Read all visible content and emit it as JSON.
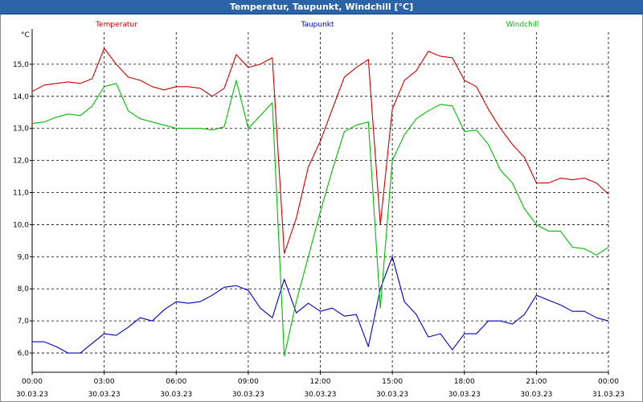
{
  "window": {
    "title": "Temperatur, Taupunkt, Windchill [°C]"
  },
  "colors": {
    "temperatur": "#cc0000",
    "taupunkt": "#0000cc",
    "windchill": "#00bb00",
    "titlebar": "#2a63a8"
  },
  "chart_data": {
    "type": "line",
    "title": "Temperatur, Taupunkt, Windchill [°C]",
    "ylabel": "°C",
    "xlabel": "",
    "ylim": [
      5.4,
      16.0
    ],
    "xlim": [
      0,
      24
    ],
    "grid": true,
    "grid_style": "dashed",
    "yticks": [
      6.0,
      7.0,
      8.0,
      9.0,
      10.0,
      11.0,
      12.0,
      13.0,
      14.0,
      15.0
    ],
    "ytick_labels": [
      "6,0",
      "7,0",
      "8,0",
      "9,0",
      "10,0",
      "11,0",
      "12,0",
      "13,0",
      "14,0",
      "15,0"
    ],
    "xticks": [
      {
        "time": "00:00",
        "date": "30.03.23"
      },
      {
        "time": "03:00",
        "date": "30.03.23"
      },
      {
        "time": "06:00",
        "date": "30.03.23"
      },
      {
        "time": "09:00",
        "date": "30.03.23"
      },
      {
        "time": "12:00",
        "date": "30.03.23"
      },
      {
        "time": "15:00",
        "date": "30.03.23"
      },
      {
        "time": "18:00",
        "date": "30.03.23"
      },
      {
        "time": "21:00",
        "date": "30.03.23"
      },
      {
        "time": "00:00",
        "date": "31.03.23"
      }
    ],
    "x": [
      0.0,
      0.5,
      1.0,
      1.5,
      2.0,
      2.5,
      3.0,
      3.5,
      4.0,
      4.5,
      5.0,
      5.5,
      6.0,
      6.5,
      7.0,
      7.5,
      8.0,
      8.5,
      9.0,
      9.5,
      10.0,
      10.5,
      11.0,
      11.5,
      12.0,
      12.5,
      13.0,
      13.5,
      14.0,
      14.5,
      15.0,
      15.5,
      16.0,
      16.5,
      17.0,
      17.5,
      18.0,
      18.5,
      19.0,
      19.5,
      20.0,
      20.5,
      21.0,
      21.5,
      22.0,
      22.5,
      23.0,
      23.5,
      24.0
    ],
    "series": [
      {
        "name": "Temperatur",
        "color": "#cc0000",
        "values": [
          14.15,
          14.35,
          14.4,
          14.45,
          14.4,
          14.55,
          15.5,
          15.0,
          14.6,
          14.5,
          14.3,
          14.2,
          14.3,
          14.3,
          14.25,
          14.0,
          14.25,
          15.3,
          14.9,
          15.0,
          15.2,
          9.1,
          10.2,
          11.8,
          12.6,
          13.6,
          14.6,
          14.9,
          15.15,
          10.0,
          13.6,
          14.5,
          14.8,
          15.4,
          15.25,
          15.2,
          14.5,
          14.3,
          13.6,
          13.0,
          12.5,
          12.1,
          11.3,
          11.3,
          11.45,
          11.4,
          11.45,
          11.3,
          10.95
        ]
      },
      {
        "name": "Taupunkt",
        "color": "#0000cc",
        "values": [
          6.35,
          6.35,
          6.2,
          6.0,
          6.0,
          6.3,
          6.6,
          6.55,
          6.8,
          7.1,
          7.0,
          7.35,
          7.6,
          7.55,
          7.6,
          7.8,
          8.05,
          8.1,
          7.95,
          7.4,
          7.1,
          8.3,
          7.25,
          7.55,
          7.3,
          7.4,
          7.15,
          7.2,
          6.2,
          8.0,
          9.0,
          7.6,
          7.2,
          6.5,
          6.6,
          6.1,
          6.6,
          6.6,
          7.0,
          7.0,
          6.9,
          7.2,
          7.8,
          7.65,
          7.5,
          7.3,
          7.3,
          7.1,
          7.0
        ]
      },
      {
        "name": "Windchill",
        "color": "#00bb00",
        "values": [
          13.15,
          13.2,
          13.35,
          13.45,
          13.4,
          13.7,
          14.3,
          14.4,
          13.55,
          13.3,
          13.2,
          13.1,
          13.0,
          13.0,
          13.0,
          12.95,
          13.05,
          14.5,
          13.0,
          13.4,
          13.8,
          5.9,
          7.6,
          9.0,
          10.4,
          11.7,
          12.9,
          13.1,
          13.2,
          7.4,
          12.0,
          12.8,
          13.3,
          13.55,
          13.75,
          13.7,
          12.9,
          12.95,
          12.5,
          11.7,
          11.3,
          10.5,
          10.0,
          9.8,
          9.8,
          9.3,
          9.25,
          9.05,
          9.3
        ]
      }
    ]
  }
}
